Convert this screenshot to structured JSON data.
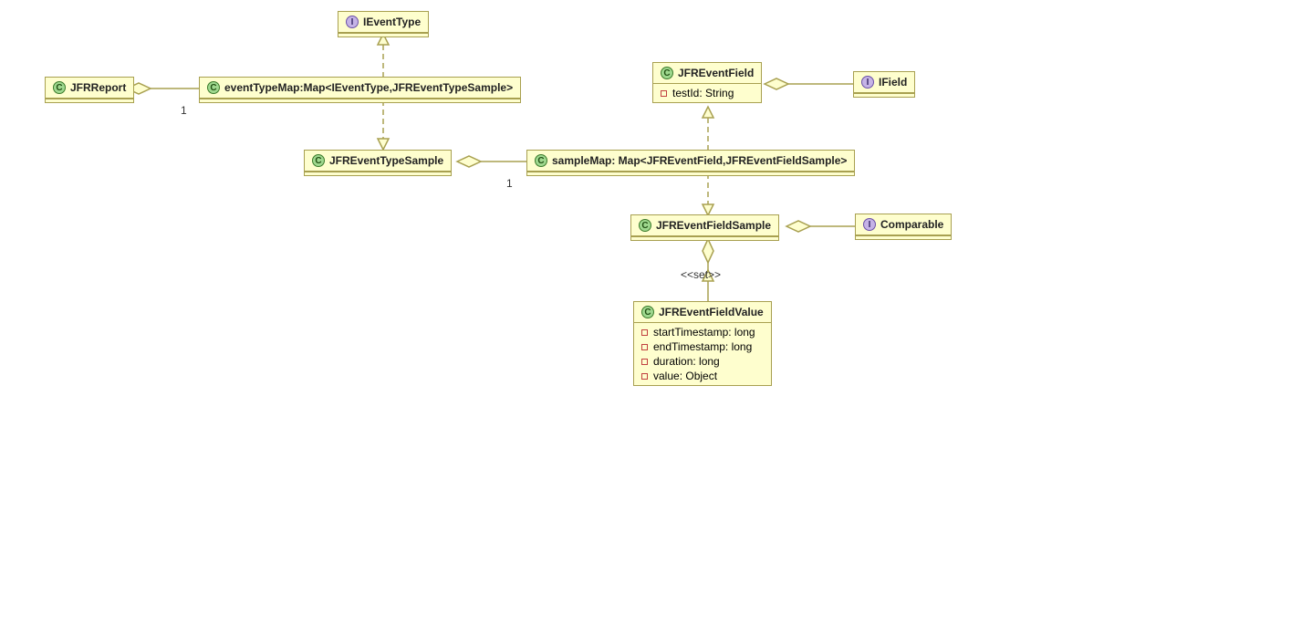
{
  "classes": {
    "IEventType": {
      "kind": "interface",
      "name": "IEventType"
    },
    "JFRReport": {
      "kind": "class",
      "name": "JFRReport"
    },
    "eventTypeMap": {
      "kind": "class",
      "name": "eventTypeMap:Map<IEventType,JFREventTypeSample>"
    },
    "JFREventTypeSample": {
      "kind": "class",
      "name": "JFREventTypeSample"
    },
    "sampleMap": {
      "kind": "class",
      "name": "sampleMap: Map<JFREventField,JFREventFieldSample>"
    },
    "JFREventField": {
      "kind": "class",
      "name": "JFREventField",
      "fields": [
        "testId: String"
      ]
    },
    "IField": {
      "kind": "interface",
      "name": "IField"
    },
    "JFREventFieldSample": {
      "kind": "class",
      "name": "JFREventFieldSample"
    },
    "Comparable": {
      "kind": "interface",
      "name": "Comparable"
    },
    "JFREventFieldValue": {
      "kind": "class",
      "name": "JFREventFieldValue",
      "fields": [
        "startTimestamp: long",
        "endTimestamp: long",
        "duration: long",
        "value: Object"
      ]
    }
  },
  "labels": {
    "one_a": "1",
    "one_b": "1",
    "set": "<<set>>"
  }
}
